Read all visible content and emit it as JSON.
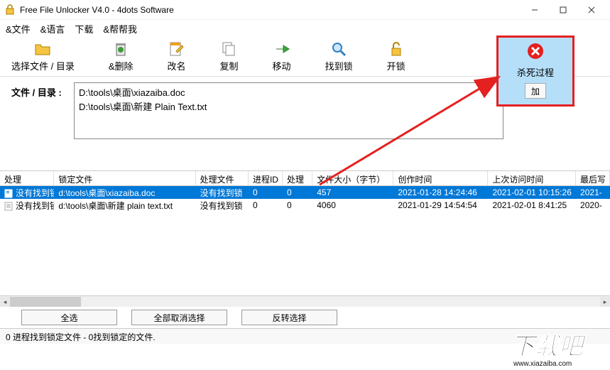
{
  "window": {
    "title": "Free File Unlocker V4.0 - 4dots Software"
  },
  "menu": {
    "file": "&文件",
    "lang": "&语言",
    "download": "下载",
    "help": "&帮帮我"
  },
  "toolbar": {
    "select": "选择文件 / 目录",
    "delete": "&删除",
    "rename": "改名",
    "copy": "复制",
    "move": "移动",
    "findlock": "找到锁",
    "unlock": "开锁",
    "kill": "杀死过程",
    "add": "加"
  },
  "paths": {
    "label": "文件 / 目录 :",
    "lines": [
      "D:\\tools\\桌面\\xiazaiba.doc",
      "D:\\tools\\桌面\\新建 Plain Text.txt"
    ]
  },
  "grid": {
    "headers": {
      "proc": "处理",
      "lockfile": "锁定文件",
      "procfile": "处理文件",
      "pid": "进程ID",
      "proc2": "处理",
      "size": "文件大小（字节）",
      "created": "创作时间",
      "accessed": "上次访问时间",
      "lastwrite": "最后写"
    },
    "rows": [
      {
        "selected": true,
        "proc": "没有找到锁",
        "lockfile": "d:\\tools\\桌面\\xiazaiba.doc",
        "procfile": "没有找到锁",
        "pid": "0",
        "proc2": "0",
        "size": "457",
        "created": "2021-01-28 14:24:46",
        "accessed": "2021-02-01 10:15:26",
        "lastwrite": "2021-"
      },
      {
        "selected": false,
        "proc": "没有找到锁",
        "lockfile": "d:\\tools\\桌面\\新建 plain text.txt",
        "procfile": "没有找到锁",
        "pid": "0",
        "proc2": "0",
        "size": "4060",
        "created": "2021-01-29 14:54:54",
        "accessed": "2021-02-01 8:41:25",
        "lastwrite": "2020-"
      }
    ]
  },
  "bottom": {
    "selectall": "全选",
    "deselectall": "全部取消选择",
    "invert": "反转选择"
  },
  "status": "0 进程找到锁定文件 - 0找到锁定的文件."
}
